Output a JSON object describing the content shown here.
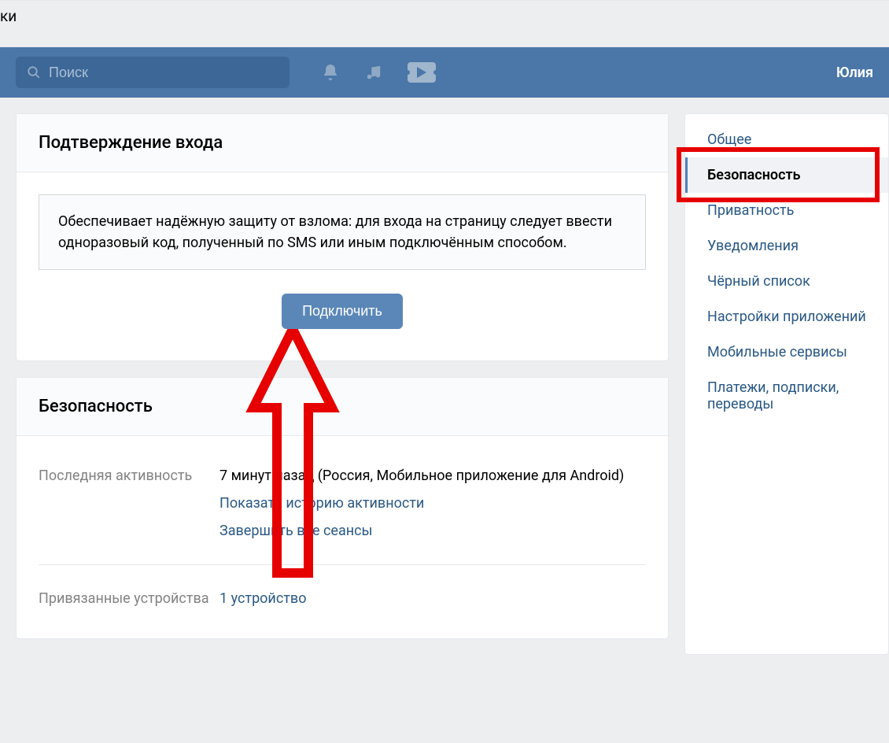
{
  "top_strip": "ки",
  "header": {
    "search_placeholder": "Поиск",
    "username": "Юлия"
  },
  "panel_confirm": {
    "title": "Подтверждение входа",
    "description": "Обеспечивает надёжную защиту от взлома: для входа на страницу следует ввести одноразовый код, полученный по SMS или иным подключённым способом.",
    "button": "Подключить"
  },
  "panel_security": {
    "title": "Безопасность",
    "last_activity_label": "Последняя активность",
    "last_activity_value": "7 минут назад (Россия, Мобильное приложение для Android)",
    "show_history": "Показать историю активности",
    "end_sessions": "Завершить все сеансы",
    "devices_label": "Привязанные устройства",
    "devices_value": "1 устройство"
  },
  "sidebar": {
    "items": [
      {
        "label": "Общее"
      },
      {
        "label": "Безопасность"
      },
      {
        "label": "Приватность"
      },
      {
        "label": "Уведомления"
      },
      {
        "label": "Чёрный список"
      },
      {
        "label": "Настройки приложений"
      },
      {
        "label": "Мобильные сервисы"
      },
      {
        "label": "Платежи, подписки, переводы"
      }
    ]
  }
}
